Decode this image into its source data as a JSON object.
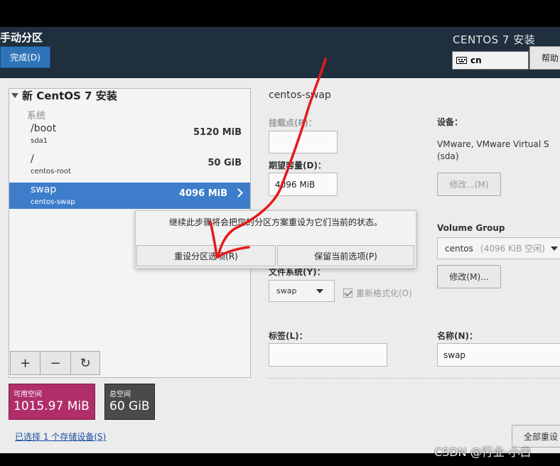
{
  "header": {
    "title": "手动分区",
    "done_label": "完成(D)",
    "product": "CENTOS 7 安装",
    "keyboard_value": "cn",
    "help_label": "帮助"
  },
  "left": {
    "install_title": "新 CentOS 7 安装",
    "group_label": "系统",
    "rows": [
      {
        "mount": "/boot",
        "device": "sda1",
        "size": "5120 MiB"
      },
      {
        "mount": "/",
        "device": "centos-root",
        "size": "50 GiB"
      },
      {
        "mount": "swap",
        "device": "centos-swap",
        "size": "4096 MiB"
      }
    ],
    "toolbar": {
      "add": "+",
      "remove": "−",
      "refresh": "↻"
    },
    "available": {
      "label": "可用空间",
      "value": "1015.97 MiB"
    },
    "total": {
      "label": "总空间",
      "value": "60 GiB"
    },
    "storage_link": "已选择 1 个存储设备(S)"
  },
  "detail": {
    "title": "centos-swap",
    "mount_point_label": "挂载点(P)：",
    "mount_point_value": "",
    "capacity_label": "期望容量(D)：",
    "capacity_value": "4096 MiB",
    "device_label": "设备：",
    "device_value_line1": "VMware, VMware Virtual S",
    "device_value_line2": "(sda)",
    "modify_label": "修改...(M)",
    "vg_label": "Volume Group",
    "vg_name": "centos",
    "vg_free": "(4096 KiB 空闲)",
    "vg_modify_label": "修改(M)...",
    "fs_label": "文件系统(Y)：",
    "fs_value": "swap",
    "reformat_label": "重新格式化(O)",
    "tag_label": "标签(L)：",
    "tag_value": "",
    "name_label": "名称(N)：",
    "name_value": "swap",
    "reset_all_label": "全部重设"
  },
  "dialog": {
    "message": "继续此步骤将会把您的分区方案重设为它们当前的状态。",
    "reset_button": "重设分区选项(R)",
    "keep_button": "保留当前选项(P)"
  },
  "watermark": "CSDN @行业-小白",
  "colors": {
    "header_bg": "#1f2f3e",
    "accent_blue": "#3d7dca",
    "available_bg": "#b02e6a",
    "total_bg": "#4a4a4a",
    "annotation_red": "#e31b1b"
  }
}
